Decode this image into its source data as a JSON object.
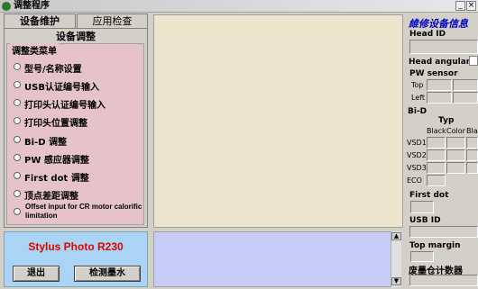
{
  "window": {
    "title": "调整程序",
    "min": "_",
    "close": "×"
  },
  "tabs": [
    "设备维护",
    "应用检查"
  ],
  "pane": {
    "title": "设备调整",
    "menu_legend": "调整类菜单",
    "items": [
      "型号/名称设置",
      "USB认证编号输入",
      "打印头认证编号输入",
      "打印头位置调整",
      "Bi-D 调整",
      "PW 感应器调整",
      "First dot 调整",
      "顶点差距调整",
      "Offset input for CR motor calorific limitation"
    ]
  },
  "model": "Stylus Photo R230",
  "buttons": {
    "exit": "退出",
    "check_ink": "检测墨水"
  },
  "right": {
    "title": "維修设备信息",
    "head_id": "Head ID",
    "head_angular": "Head angular",
    "pw_sensor": "PW sensor",
    "top": "Top",
    "left": "Left",
    "bid": "Bi-D",
    "typ": "Typ",
    "cols": [
      "Black",
      "Color",
      "Bla"
    ],
    "rows": [
      "VSD1",
      "VSD2",
      "VSD3",
      "ECO"
    ],
    "first_dot": "First dot",
    "usb_id": "USB ID",
    "top_margin": "Top margin",
    "ink_counter": "废墨仓计数器"
  }
}
